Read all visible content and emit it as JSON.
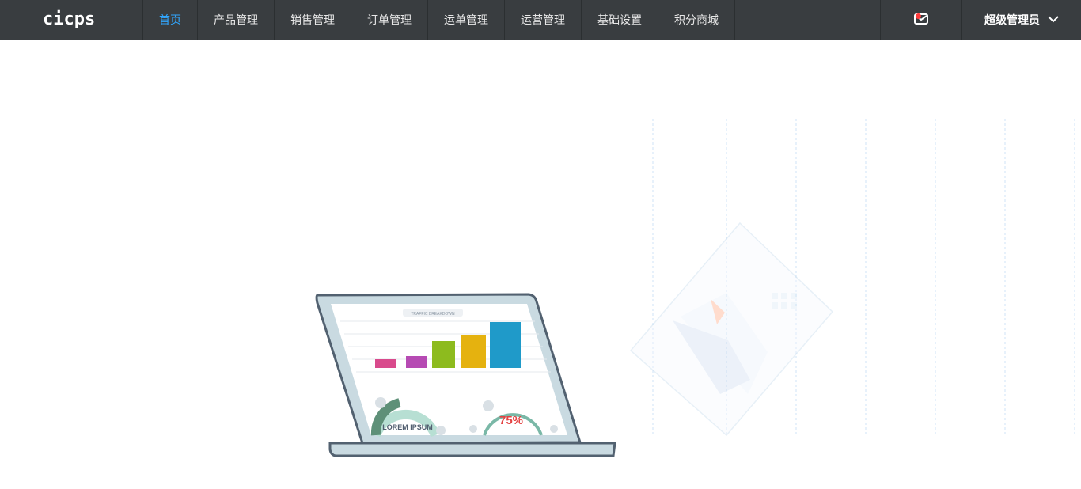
{
  "app": {
    "logo_text": "cicps"
  },
  "nav": {
    "items": [
      {
        "label": "首页",
        "active": true
      },
      {
        "label": "产品管理",
        "active": false
      },
      {
        "label": "销售管理",
        "active": false
      },
      {
        "label": "订单管理",
        "active": false
      },
      {
        "label": "运单管理",
        "active": false
      },
      {
        "label": "运营管理",
        "active": false
      },
      {
        "label": "基础设置",
        "active": false
      },
      {
        "label": "积分商城",
        "active": false
      }
    ]
  },
  "header": {
    "user_name": "超级管理员",
    "icons": {
      "mail": "mail-icon",
      "user_dropdown": "chevron-down-icon"
    }
  },
  "illustration": {
    "laptop_title": "TRAFFIC BREAKDOWN",
    "donut_text": "LOREM IPSUM",
    "percent_text": "75%",
    "colors": {
      "bar1": "#d94a8c",
      "bar2": "#b64ab3",
      "bar3": "#8dbb1e",
      "bar4": "#e5b20f",
      "bar5": "#1f9ac9",
      "laptop_body": "#c9dae1",
      "laptop_stroke": "#526170"
    }
  }
}
